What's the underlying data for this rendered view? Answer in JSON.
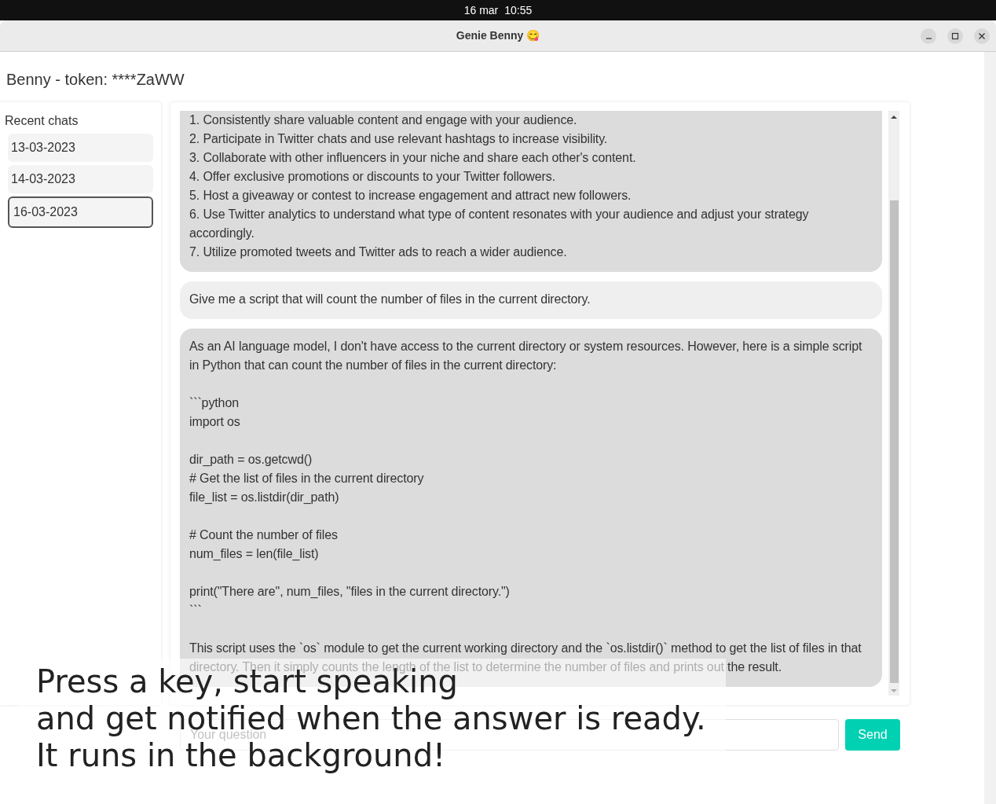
{
  "top_bar": {
    "date": "16 mar",
    "time": "10:55"
  },
  "window": {
    "title": "Genie Benny 😋"
  },
  "header": "Benny - token: ****ZaWW",
  "sidebar": {
    "title": "Recent chats",
    "items": [
      {
        "label": "13-03-2023",
        "selected": false
      },
      {
        "label": "14-03-2023",
        "selected": false
      },
      {
        "label": "16-03-2023",
        "selected": true
      }
    ]
  },
  "messages": [
    {
      "kind": "assistant",
      "text": "1. Consistently share valuable content and engage with your audience.\n2. Participate in Twitter chats and use relevant hashtags to increase visibility.\n3. Collaborate with other influencers in your niche and share each other's content.\n4. Offer exclusive promotions or discounts to your Twitter followers.\n5. Host a giveaway or contest to increase engagement and attract new followers.\n6. Use Twitter analytics to understand what type of content resonates with your audience and adjust your strategy accordingly.\n7. Utilize promoted tweets and Twitter ads to reach a wider audience."
    },
    {
      "kind": "user",
      "text": "Give me a script that will count the number of files in the current directory."
    },
    {
      "kind": "assistant",
      "text": "As an AI language model, I don't have access to the current directory or system resources. However, here is a simple script in Python that can count the number of files in the current directory:\n\n```python\nimport os\n\ndir_path = os.getcwd()\n# Get the list of files in the current directory\nfile_list = os.listdir(dir_path)\n\n# Count the number of files\nnum_files = len(file_list)\n\nprint(\"There are\", num_files, \"files in the current directory.\")\n```\n\nThis script uses the `os` module to get the current working directory and the `os.listdir()` method to get the list of files in that directory. Then it simply counts the length of the list to determine the number of files and prints out the result."
    }
  ],
  "input": {
    "placeholder": "Your question"
  },
  "send_button": "Send",
  "caption": "Press a key, start speaking\nand get notified when the answer is ready.\nIt runs in the background!"
}
